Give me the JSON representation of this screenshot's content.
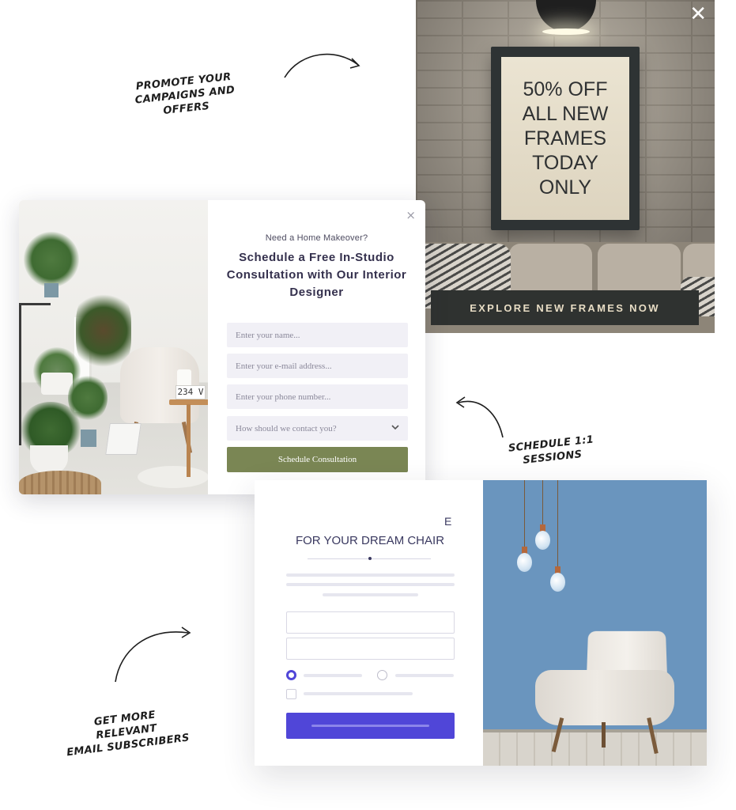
{
  "annotations": {
    "promote": "PROMOTE YOUR CAMPAIGNS AND\nOFFERS",
    "schedule": "SCHEDULE 1:1 SESSIONS",
    "subscribers": "GET MORE RELEVANT\nEMAIL SUBSCRIBERS"
  },
  "promo_popup": {
    "headline": "50% OFF\nALL NEW\nFRAMES\nTODAY\nONLY",
    "cta_label": "EXPLORE NEW FRAMES NOW",
    "close_glyph": "✕",
    "accent_color": "#2f3230"
  },
  "consult_popup": {
    "pretitle": "Need a Home Makeover?",
    "title": "Schedule a Free In-Studio Consultation with Our Interior Designer",
    "name_placeholder": "Enter your name...",
    "email_placeholder": "Enter your e-mail address...",
    "phone_placeholder": "Enter your phone number...",
    "contact_select": "How should we contact you?",
    "submit_label": "Schedule Consultation",
    "close_glyph": "×",
    "photo_box_label": "234 V",
    "accent_color": "#7a8654"
  },
  "chair_popup": {
    "title_fragment": "E",
    "title": "FOR YOUR DREAM CHAIR",
    "accent_color": "#5046d8"
  }
}
